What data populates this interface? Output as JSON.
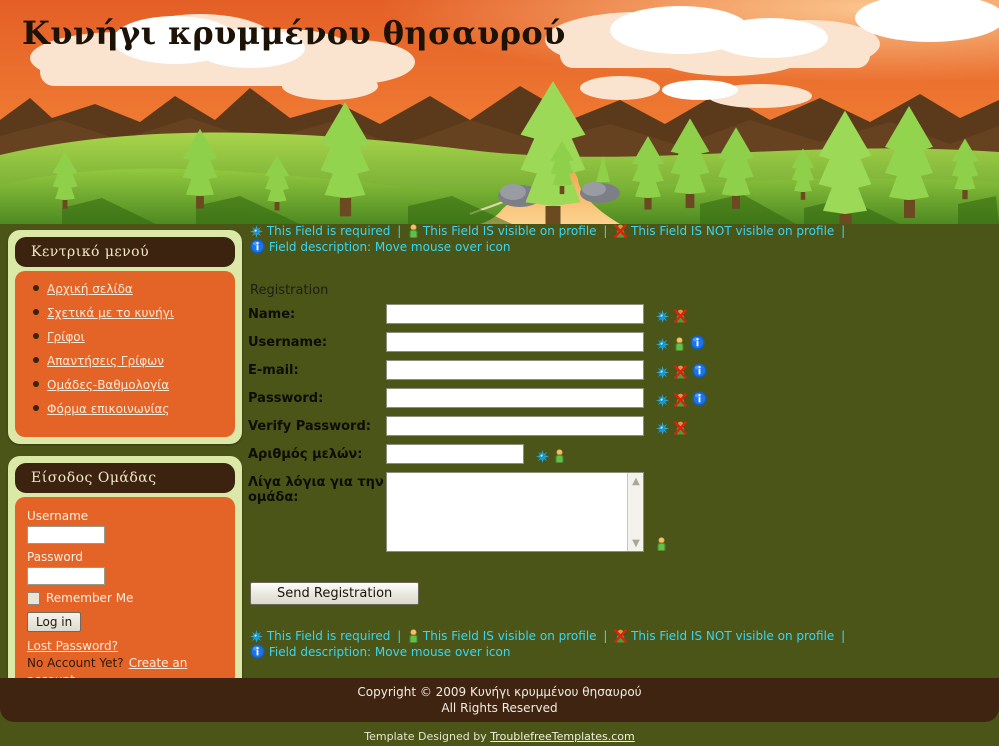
{
  "site": {
    "title": "Κυνήγι κρυμμένου θησαυρού"
  },
  "banner": {
    "name": "sunset-forest-landscape",
    "sky_color": "#ef7330",
    "hill_color": "#8dc63f",
    "mountain_color": "#5b3a1c"
  },
  "sidebar": {
    "menu_panel": {
      "title": "Κεντρικό μενού",
      "items": [
        {
          "label": "Αρχική σελίδα"
        },
        {
          "label": "Σχετικά με το κυνήγι"
        },
        {
          "label": "Γρίφοι"
        },
        {
          "label": "Απαντήσεις Γρίφων"
        },
        {
          "label": "Ομάδες-Βαθμολογία"
        },
        {
          "label": "Φόρμα επικοινωνίας"
        }
      ]
    },
    "login_panel": {
      "title": "Είσοδος Ομάδας",
      "username_label": "Username",
      "username_value": "",
      "password_label": "Password",
      "password_value": "",
      "remember_label": "Remember Me",
      "remember_checked": false,
      "login_button": "Log in",
      "lost_password": "Lost Password?",
      "no_account_text": "No Account Yet?",
      "create_account": "Create an account"
    }
  },
  "legend": {
    "required": "This Field is required",
    "visible": "This Field IS visible on profile",
    "not_visible": "This Field IS NOT visible on profile",
    "description": "Field description: Move mouse over icon",
    "separator": "|",
    "text_color": "#39d6f0"
  },
  "registration": {
    "heading": "Registration",
    "fields": [
      {
        "label": "Name:",
        "value": "",
        "type": "text",
        "icons": [
          "required-star-icon",
          "not-visible-icon"
        ]
      },
      {
        "label": "Username:",
        "value": "",
        "type": "text",
        "icons": [
          "required-star-icon",
          "visible-person-icon",
          "info-icon"
        ]
      },
      {
        "label": "E-mail:",
        "value": "",
        "type": "text",
        "icons": [
          "required-star-icon",
          "not-visible-icon",
          "info-icon"
        ]
      },
      {
        "label": "Password:",
        "value": "",
        "type": "password",
        "icons": [
          "required-star-icon",
          "not-visible-icon",
          "info-icon"
        ]
      },
      {
        "label": "Verify Password:",
        "value": "",
        "type": "password",
        "icons": [
          "required-star-icon",
          "not-visible-icon"
        ]
      },
      {
        "label": "Αριθμός μελών:",
        "value": "",
        "type": "text-short",
        "icons": [
          "required-star-icon",
          "visible-person-icon"
        ]
      },
      {
        "label": "Λίγα λόγια για την ομάδα:",
        "value": "",
        "type": "textarea",
        "icons": [
          "visible-person-icon"
        ]
      }
    ],
    "submit_label": "Send Registration"
  },
  "footer": {
    "copyright_line1": "Copyright © 2009 Κυνήγι κρυμμένου θησαυρού",
    "copyright_line2": "All Rights Reserved",
    "credit_prefix": "Template Designed by",
    "credit_link": "TroublefreeTemplates.com"
  }
}
